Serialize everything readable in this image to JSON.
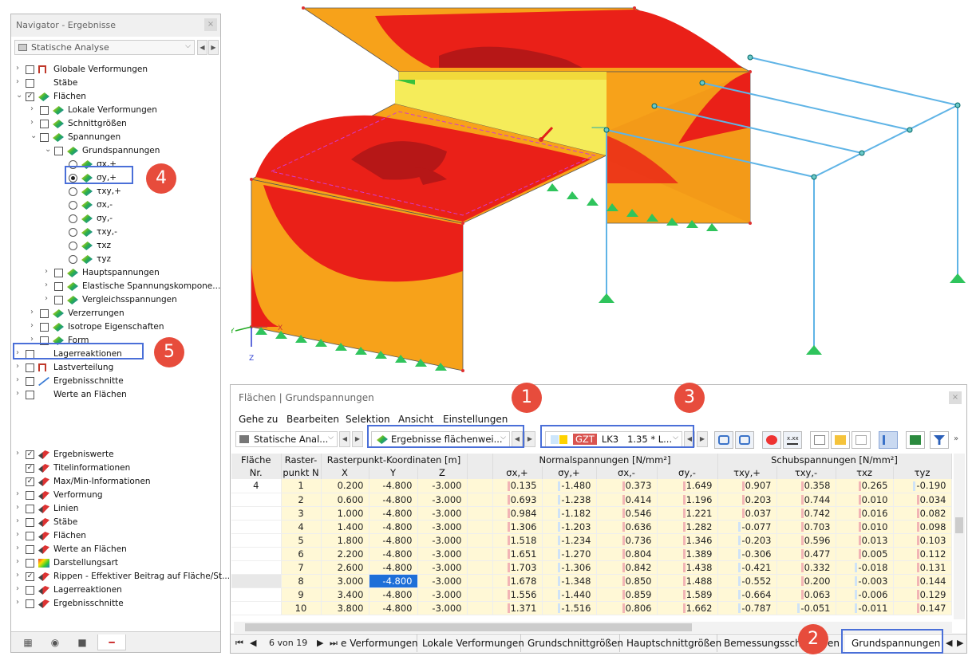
{
  "navigator": {
    "title": "Navigator - Ergebnisse",
    "close": "×",
    "combo": "Statische Analyse",
    "prev": "◀",
    "next": "▶",
    "tree": [
      {
        "label": "Globale Verformungen",
        "level": 0,
        "exp": "›",
        "chk": "",
        "icon": "def"
      },
      {
        "label": "Stäbe",
        "level": 0,
        "exp": "›",
        "chk": "",
        "icon": "bar"
      },
      {
        "label": "Flächen",
        "level": 0,
        "exp": "⌄",
        "chk": "✓",
        "icon": "surf"
      },
      {
        "label": "Lokale Verformungen",
        "level": 1,
        "exp": "›",
        "chk": "",
        "icon": "surf"
      },
      {
        "label": "Schnittgrößen",
        "level": 1,
        "exp": "›",
        "chk": "",
        "icon": "surf"
      },
      {
        "label": "Spannungen",
        "level": 1,
        "exp": "⌄",
        "chk": "",
        "icon": "surf"
      },
      {
        "label": "Grundspannungen",
        "level": 2,
        "exp": "⌄",
        "chk": "",
        "icon": "surf"
      }
    ],
    "radios": [
      {
        "label": "σx,+",
        "on": false
      },
      {
        "label": "σy,+",
        "on": true
      },
      {
        "label": "τxy,+",
        "on": false
      },
      {
        "label": "σx,-",
        "on": false
      },
      {
        "label": "σy,-",
        "on": false
      },
      {
        "label": "τxy,-",
        "on": false
      },
      {
        "label": "τxz",
        "on": false
      },
      {
        "label": "τyz",
        "on": false
      }
    ],
    "tree2": [
      {
        "label": "Hauptspannungen",
        "level": 2
      },
      {
        "label": "Elastische Spannungskompone...",
        "level": 2
      },
      {
        "label": "Vergleichsspannungen",
        "level": 2
      },
      {
        "label": "Verzerrungen",
        "level": 1
      },
      {
        "label": "Isotrope Eigenschaften",
        "level": 1
      },
      {
        "label": "Form",
        "level": 1
      }
    ],
    "tree3": [
      {
        "label": "Lagerreaktionen",
        "icon": "sup"
      },
      {
        "label": "Lastverteilung",
        "icon": "def"
      },
      {
        "label": "Ergebnisschnitte",
        "icon": "line"
      },
      {
        "label": "Werte an Flächen",
        "icon": "bar"
      }
    ],
    "display": [
      {
        "label": "Ergebniswerte",
        "chk": "✓",
        "exp": "›"
      },
      {
        "label": "Titelinformationen",
        "chk": "✓",
        "exp": ""
      },
      {
        "label": "Max/Min-Informationen",
        "chk": "✓",
        "exp": ""
      },
      {
        "label": "Verformung",
        "chk": "",
        "exp": "›"
      },
      {
        "label": "Linien",
        "chk": "",
        "exp": "›"
      },
      {
        "label": "Stäbe",
        "chk": "",
        "exp": "›"
      },
      {
        "label": "Flächen",
        "chk": "",
        "exp": "›"
      },
      {
        "label": "Werte an Flächen",
        "chk": "",
        "exp": "›"
      },
      {
        "label": "Darstellungsart",
        "chk": "",
        "exp": "›"
      },
      {
        "label": "Rippen - Effektiver Beitrag auf Fläche/St...",
        "chk": "✓",
        "exp": "›"
      },
      {
        "label": "Lagerreaktionen",
        "chk": "",
        "exp": "›"
      },
      {
        "label": "Ergebnisschnitte",
        "chk": "",
        "exp": "›"
      }
    ],
    "bottom_tabs": [
      "data-icon",
      "eye-icon",
      "camera-icon",
      "result-icon"
    ]
  },
  "badges": [
    "1",
    "2",
    "3",
    "4",
    "5"
  ],
  "axes": {
    "y": "Y",
    "x": "X",
    "z": "Z"
  },
  "results": {
    "title": "Flächen | Grundspannungen",
    "close": "×",
    "menu": [
      "Gehe zu",
      "Bearbeiten",
      "Selektion",
      "Ansicht",
      "Einstellungen"
    ],
    "combo_analysis": "Statische Anal...",
    "combo_results": "Ergebnisse flächenwei...",
    "combo_lk": {
      "tag": "GZT",
      "lk": "LK3",
      "text": "1.35 * L..."
    },
    "colors": {
      "gzt": "#d9534f",
      "lk_swatch": "#ffd200",
      "selected": "#1e6fd8"
    },
    "header_groups": {
      "flaeche": "Fläche",
      "nr": "Nr.",
      "raster": "Raster-",
      "punkt": "punkt N",
      "coords": "Rasterpunkt-Koordinaten [m]",
      "normal": "Normalspannungen [N/mm²]",
      "schub": "Schubspannungen [N/mm²]"
    },
    "columns": [
      "X",
      "Y",
      "Z",
      "σx,+",
      "σy,+",
      "σx,-",
      "σy,-",
      "τxy,+",
      "τxy,-",
      "τxz",
      "τyz"
    ],
    "surface_no": "4",
    "rows": [
      [
        "1",
        "0.200",
        "-4.800",
        "-3.000",
        "0.135",
        "-1.480",
        "0.373",
        "1.649",
        "0.907",
        "0.358",
        "0.265",
        "-0.190"
      ],
      [
        "2",
        "0.600",
        "-4.800",
        "-3.000",
        "0.693",
        "-1.238",
        "0.414",
        "1.196",
        "0.203",
        "0.744",
        "0.010",
        "0.034"
      ],
      [
        "3",
        "1.000",
        "-4.800",
        "-3.000",
        "0.984",
        "-1.182",
        "0.546",
        "1.221",
        "0.037",
        "0.742",
        "0.016",
        "0.082"
      ],
      [
        "4",
        "1.400",
        "-4.800",
        "-3.000",
        "1.306",
        "-1.203",
        "0.636",
        "1.282",
        "-0.077",
        "0.703",
        "0.010",
        "0.098"
      ],
      [
        "5",
        "1.800",
        "-4.800",
        "-3.000",
        "1.518",
        "-1.234",
        "0.736",
        "1.346",
        "-0.203",
        "0.596",
        "0.013",
        "0.103"
      ],
      [
        "6",
        "2.200",
        "-4.800",
        "-3.000",
        "1.651",
        "-1.270",
        "0.804",
        "1.389",
        "-0.306",
        "0.477",
        "0.005",
        "0.112"
      ],
      [
        "7",
        "2.600",
        "-4.800",
        "-3.000",
        "1.703",
        "-1.306",
        "0.842",
        "1.438",
        "-0.421",
        "0.332",
        "-0.018",
        "0.131"
      ],
      [
        "8",
        "3.000",
        "-4.800",
        "-3.000",
        "1.678",
        "-1.348",
        "0.850",
        "1.488",
        "-0.552",
        "0.200",
        "-0.003",
        "0.144"
      ],
      [
        "9",
        "3.400",
        "-4.800",
        "-3.000",
        "1.556",
        "-1.440",
        "0.859",
        "1.589",
        "-0.664",
        "0.063",
        "-0.006",
        "0.129"
      ],
      [
        "10",
        "3.800",
        "-4.800",
        "-3.000",
        "1.371",
        "-1.516",
        "0.806",
        "1.662",
        "-0.787",
        "-0.051",
        "-0.011",
        "0.147"
      ]
    ],
    "pager": "6 von 19",
    "tabs": [
      "e Verformungen",
      "Lokale Verformungen",
      "Grundschnittgrößen",
      "Hauptschnittgrößen",
      "Bemessungsschn",
      "Grundspannungen"
    ],
    "tabs_tail": "en"
  }
}
